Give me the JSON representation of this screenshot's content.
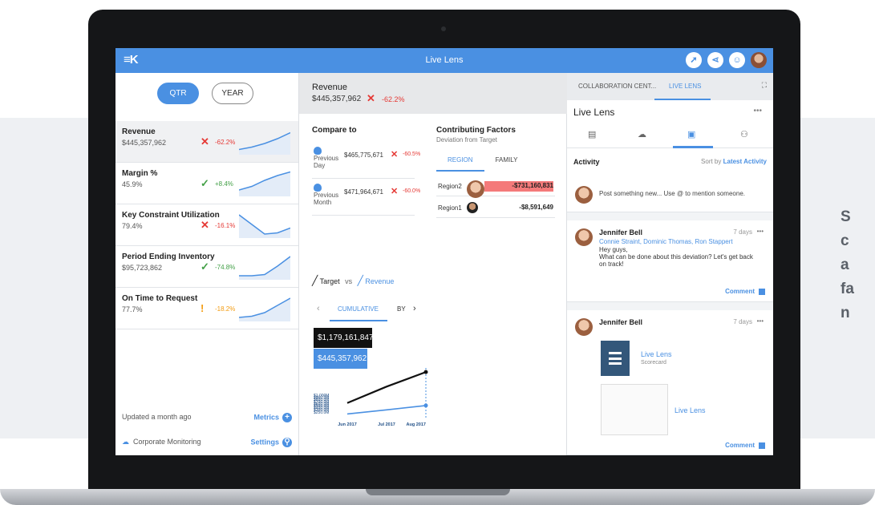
{
  "side_text": "S\nc\na\nfa\nn",
  "app": {
    "logo": "K",
    "title": "Live Lens",
    "top_icons": [
      "rocket-icon",
      "share-icon",
      "team-icon",
      "user-avatar"
    ]
  },
  "left_panel": {
    "toggle": {
      "qtr": "QTR",
      "year": "YEAR",
      "selected": "QTR"
    },
    "metrics": [
      {
        "name": "Revenue",
        "value": "$445,357,962",
        "status": "down",
        "symbol": "✕",
        "change": "-62.2%",
        "selected": true,
        "trend": [
          0.15,
          0.25,
          0.4,
          0.6,
          0.85
        ]
      },
      {
        "name": "Margin %",
        "value": "45.9%",
        "status": "up",
        "symbol": "✓",
        "change": "+8.4%",
        "selected": false,
        "trend": [
          0.2,
          0.35,
          0.6,
          0.8,
          0.95
        ]
      },
      {
        "name": "Key Constraint Utilization",
        "value": "79.4%",
        "status": "down",
        "symbol": "✕",
        "change": "-16.1%",
        "selected": false,
        "trend": [
          0.9,
          0.5,
          0.1,
          0.15,
          0.35
        ]
      },
      {
        "name": "Period Ending Inventory",
        "value": "$95,723,862",
        "status": "up",
        "symbol": "✓",
        "change": "-74.8%",
        "selected": false,
        "trend": [
          0.1,
          0.1,
          0.15,
          0.5,
          0.9
        ]
      },
      {
        "name": "On Time to Request",
        "value": "77.7%",
        "status": "warn",
        "symbol": "!",
        "change": "-18.2%",
        "selected": false,
        "trend": [
          0.1,
          0.15,
          0.3,
          0.6,
          0.9
        ]
      }
    ],
    "updated": "Updated a month ago",
    "metrics_link": "Metrics",
    "corporate": "Corporate Monitoring",
    "settings_link": "Settings"
  },
  "middle_panel": {
    "header": {
      "title": "Revenue",
      "value": "$445,357,962",
      "symbol": "✕",
      "change": "-62.2%"
    },
    "compare_title": "Compare to",
    "compare_rows": [
      {
        "label": "Previous Day",
        "value": "$465,775,671",
        "symbol": "✕",
        "change": "-60.5%"
      },
      {
        "label": "Previous Month",
        "value": "$471,964,671",
        "symbol": "✕",
        "change": "-60.0%"
      }
    ],
    "contrib_title": "Contributing Factors",
    "contrib_sub": "Deviation from Target",
    "contrib_tabs": [
      "REGION",
      "FAMILY"
    ],
    "contrib_rows": [
      {
        "name": "Region2",
        "value": "-$731,160,831",
        "bar_fraction": 1.0
      },
      {
        "name": "Region1",
        "value": "-$8,591,649",
        "bar_fraction": 0.0
      }
    ],
    "target_label": "Target",
    "vs_label": "vs",
    "revenue_label": "Revenue",
    "cum_tabs": {
      "cumulative": "CUMULATIVE",
      "by": "BY"
    },
    "target_value": "$1,179,161,847",
    "revenue_value": "$445,357,962"
  },
  "chart_data": {
    "type": "line",
    "x": [
      "Jun 2017",
      "Jul 2017",
      "Aug 2017"
    ],
    "y_ticks": [
      "$1,000M",
      "$900.0M",
      "$800.0M",
      "$700.0M",
      "$600.0M",
      "$500.0M",
      "$400.0M",
      "$300.0M",
      "$250.0M"
    ],
    "series": [
      {
        "name": "Target",
        "color": "#111111",
        "values": [
          500,
          860,
          1180
        ]
      },
      {
        "name": "Revenue",
        "color": "#4a90e2",
        "values": [
          260,
          350,
          445
        ]
      }
    ],
    "ylim": [
      250,
      1200
    ]
  },
  "right_panel": {
    "tabs": [
      "COLLABORATION CENT...",
      "LIVE LENS"
    ],
    "active_tab": "LIVE LENS",
    "title": "Live Lens",
    "icons": [
      "document-icon",
      "cloud-icon",
      "chat-icon",
      "people-icon"
    ],
    "activity_title": "Activity",
    "sort_label": "Sort by",
    "sort_value": "Latest Activity",
    "post_placeholder": "Post something new... Use @ to mention someone.",
    "cards": [
      {
        "name": "Jennifer Bell",
        "time": "7 days",
        "mentions": "Connie Straint, Dominic Thomas, Ron Stappert",
        "body": "Hey guys,\nWhat can be done about this deviation? Let's get back on track!",
        "comment": "Comment"
      },
      {
        "name": "Jennifer Bell",
        "time": "7 days",
        "scorecard_title": "Live Lens",
        "scorecard_sub": "Scorecard",
        "thumb_title": "Live Lens",
        "comment": "Comment"
      }
    ]
  }
}
